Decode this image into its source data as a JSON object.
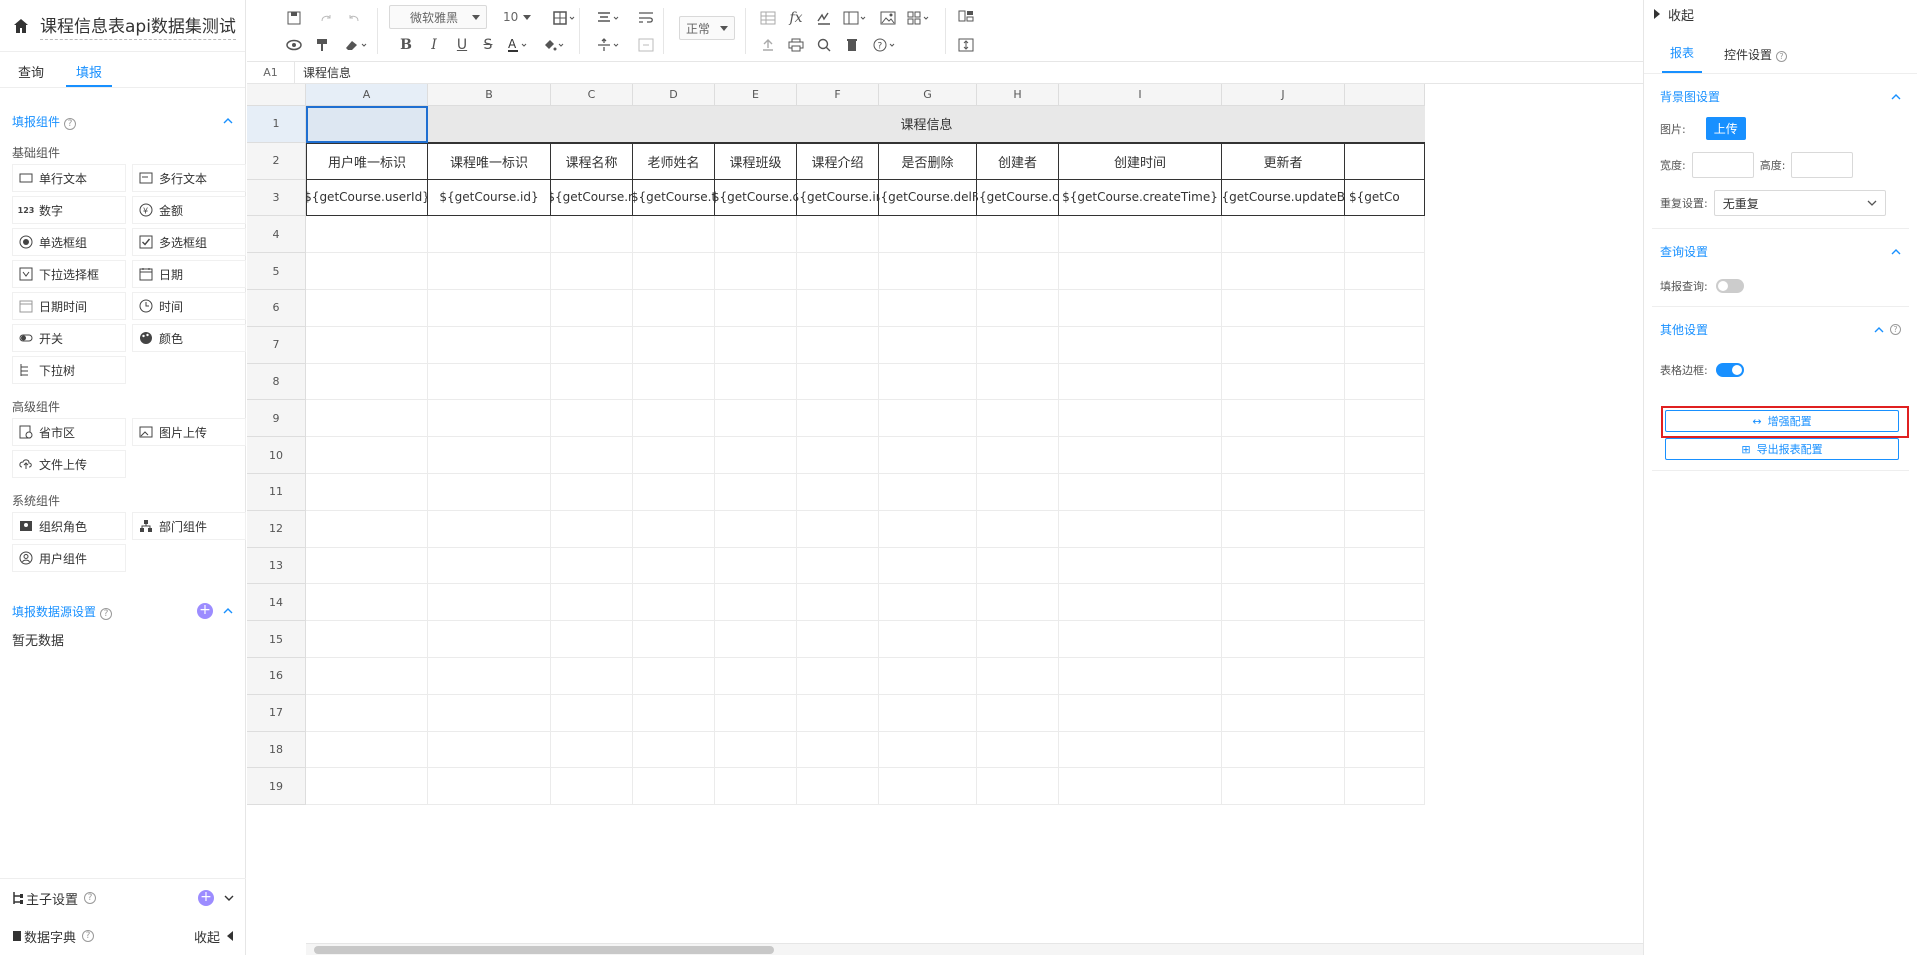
{
  "app": {
    "title": "课程信息表api数据集测试"
  },
  "left": {
    "tabs": [
      {
        "label": "查询"
      },
      {
        "label": "填报"
      }
    ],
    "fill_components": {
      "header": "填报组件",
      "basic_label": "基础组件",
      "basic": [
        {
          "label": "单行文本",
          "icon": "single-line-text-icon"
        },
        {
          "label": "多行文本",
          "icon": "multi-line-text-icon"
        },
        {
          "label": "数字",
          "icon": "number-icon",
          "glyph": "123"
        },
        {
          "label": "金额",
          "icon": "money-icon"
        },
        {
          "label": "单选框组",
          "icon": "radio-icon"
        },
        {
          "label": "多选框组",
          "icon": "checkbox-icon"
        },
        {
          "label": "下拉选择框",
          "icon": "dropdown-icon"
        },
        {
          "label": "日期",
          "icon": "date-icon"
        },
        {
          "label": "日期时间",
          "icon": "datetime-icon"
        },
        {
          "label": "时间",
          "icon": "time-icon"
        },
        {
          "label": "开关",
          "icon": "switch-icon"
        },
        {
          "label": "颜色",
          "icon": "color-icon"
        },
        {
          "label": "下拉树",
          "icon": "tree-dropdown-icon"
        }
      ],
      "advanced_label": "高级组件",
      "advanced": [
        {
          "label": "省市区",
          "icon": "region-icon"
        },
        {
          "label": "图片上传",
          "icon": "image-upload-icon"
        },
        {
          "label": "文件上传",
          "icon": "file-upload-icon"
        }
      ],
      "system_label": "系统组件",
      "system": [
        {
          "label": "组织角色",
          "icon": "org-role-icon"
        },
        {
          "label": "部门组件",
          "icon": "department-icon"
        },
        {
          "label": "用户组件",
          "icon": "user-icon"
        }
      ]
    },
    "datasource": {
      "header": "填报数据源设置",
      "empty": "暂无数据"
    },
    "bottom": {
      "master_detail": "主子设置",
      "dictionary": "数据字典",
      "collapse": "收起"
    }
  },
  "toolbar": {
    "font_family": "微软雅黑",
    "font_size": "10",
    "format": "正常"
  },
  "formula_bar": {
    "cell_ref": "A1",
    "value": "课程信息"
  },
  "sheet": {
    "columns": [
      "A",
      "B",
      "C",
      "D",
      "E",
      "F",
      "G",
      "H",
      "I",
      "J",
      ""
    ],
    "rows": [
      "1",
      "2",
      "3",
      "4",
      "5",
      "6",
      "7",
      "8",
      "9",
      "10",
      "11",
      "12",
      "13",
      "14",
      "15",
      "16",
      "17",
      "18",
      "19"
    ],
    "merged_title": "课程信息",
    "headers": [
      "用户唯一标识",
      "课程唯一标识",
      "课程名称",
      "老师姓名",
      "课程班级",
      "课程介绍",
      "是否删除",
      "创建者",
      "创建时间",
      "更新者",
      ""
    ],
    "bindings": [
      "${getCourse.userId}",
      "${getCourse.id}",
      "${getCourse.n",
      "${getCourse.t",
      "${getCourse.c",
      "${getCourse.in",
      "${getCourse.delFl",
      "${getCourse.cr",
      "${getCourse.createTime}",
      "${getCourse.updateBy",
      "${getCo"
    ]
  },
  "right": {
    "collapse": "收起",
    "tabs": [
      {
        "label": "报表"
      },
      {
        "label": "控件设置"
      }
    ],
    "background": {
      "header": "背景图设置",
      "image_label": "图片:",
      "upload": "上传",
      "width_label": "宽度:",
      "height_label": "高度:",
      "repeat_label": "重复设置:",
      "repeat_value": "无重复"
    },
    "query": {
      "header": "查询设置",
      "fill_query_label": "填报查询:",
      "fill_query_on": false
    },
    "other": {
      "header": "其他设置",
      "border_label": "表格边框:",
      "border_on": true,
      "enhance_button": "增强配置",
      "export_button": "导出报表配置"
    }
  }
}
